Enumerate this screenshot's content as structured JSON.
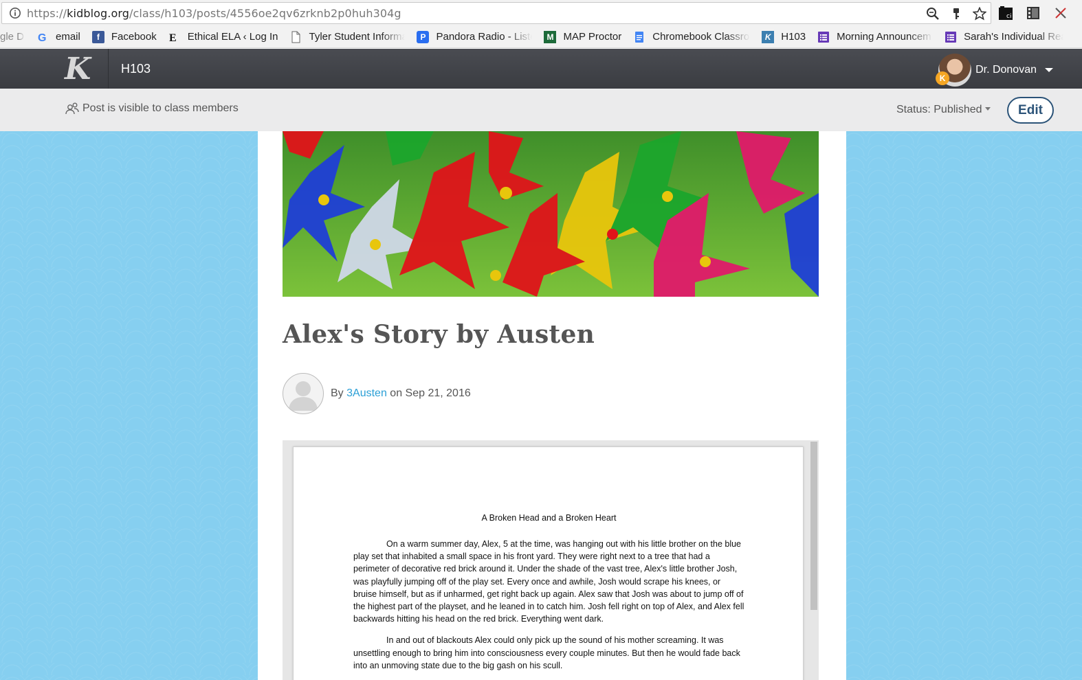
{
  "browser": {
    "url_scheme": "https://",
    "url_host": "kidblog.org",
    "url_path": "/class/h103/posts/4556oe2qv6zrknb2p0huh304g",
    "bookmarks": [
      {
        "label": "gle Dr",
        "icon": "google-drive-icon"
      },
      {
        "label": "email",
        "icon": "google-icon"
      },
      {
        "label": "Facebook",
        "icon": "facebook-icon"
      },
      {
        "label": "Ethical ELA ‹ Log In",
        "icon": "ethical-ela-icon"
      },
      {
        "label": "Tyler Student Informa",
        "icon": "page-icon"
      },
      {
        "label": "Pandora Radio - Liste",
        "icon": "pandora-icon"
      },
      {
        "label": "MAP Proctor",
        "icon": "map-icon"
      },
      {
        "label": "Chromebook Classroo",
        "icon": "docs-icon"
      },
      {
        "label": "H103",
        "icon": "kidblog-icon"
      },
      {
        "label": "Morning Announcem",
        "icon": "forms-icon"
      },
      {
        "label": "Sarah's Individual Rea",
        "icon": "forms-icon"
      }
    ]
  },
  "nav": {
    "class_name": "H103",
    "user_name": "Dr. Donovan",
    "logo_letter": "K"
  },
  "post_bar": {
    "visibility": "Post is visible to class members",
    "status": "Status: Published",
    "edit_label": "Edit"
  },
  "post": {
    "title": "Alex's Story by Austen",
    "by": "By",
    "author": "3Austen",
    "date": "on Sep 21, 2016"
  },
  "document": {
    "title": "A Broken Head and a Broken Heart",
    "paragraphs": [
      "On a warm summer day, Alex, 5 at the time, was hanging out with his little brother on the blue play set that inhabited a small space in his front yard. They were right next to a tree that had a perimeter of decorative red brick around it. Under the shade of the vast tree, Alex's little brother Josh, was playfully jumping off of the play set. Every once and awhile, Josh would scrape his knees, or bruise himself, but as if unharmed, get right back up again. Alex saw that Josh was about to jump off of the highest part of the playset, and he leaned in to catch him. Josh fell right on top of Alex, and Alex fell backwards hitting his head on the red brick. Everything went dark.",
      "In and out of blackouts Alex could only pick up the sound of his mother screaming. It was unsettling enough to bring him into consciousness every couple minutes. But then he would fade back into an unmoving state due to the big gash on his scull."
    ]
  },
  "colors": {
    "nav_bg": "#3f4146",
    "page_bg": "#86cff0",
    "link": "#2a9fd6",
    "edit_border": "#2b5378"
  }
}
